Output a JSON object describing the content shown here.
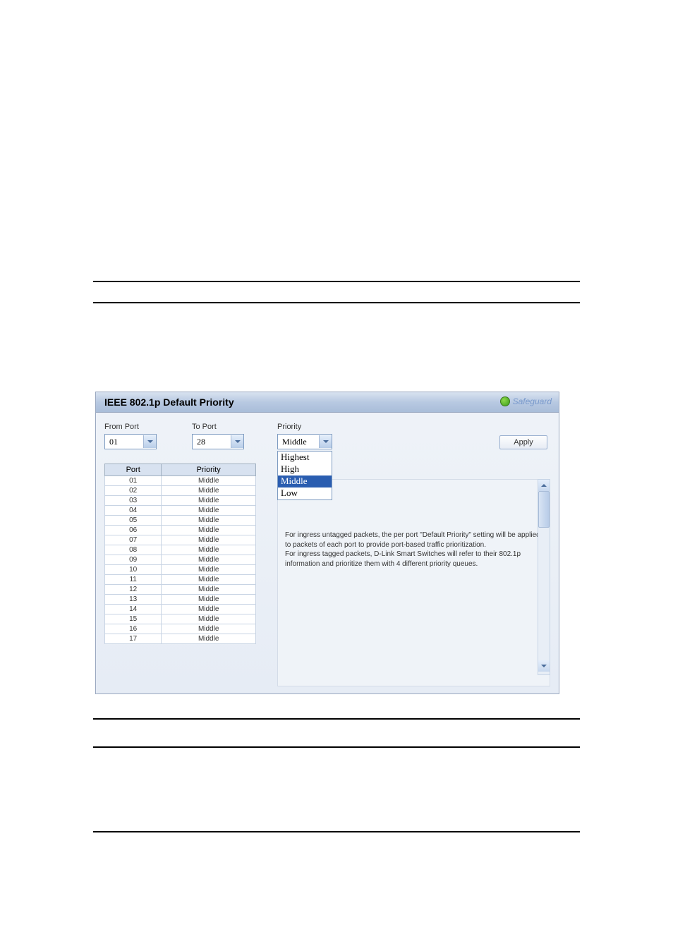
{
  "titlebar": {
    "title": "IEEE 802.1p Default Priority",
    "safeguard_text": "Safeguard"
  },
  "controls": {
    "from_port_label": "From Port",
    "from_port_value": "01",
    "to_port_label": "To Port",
    "to_port_value": "28",
    "priority_label": "Priority",
    "priority_value": "Middle",
    "apply_label": "Apply"
  },
  "dropdown_options": {
    "0": "Highest",
    "1": "High",
    "2": "Middle",
    "3": "Low"
  },
  "port_table": {
    "header_port": "Port",
    "header_priority": "Priority",
    "rows": [
      {
        "port": "01",
        "priority": "Middle"
      },
      {
        "port": "02",
        "priority": "Middle"
      },
      {
        "port": "03",
        "priority": "Middle"
      },
      {
        "port": "04",
        "priority": "Middle"
      },
      {
        "port": "05",
        "priority": "Middle"
      },
      {
        "port": "06",
        "priority": "Middle"
      },
      {
        "port": "07",
        "priority": "Middle"
      },
      {
        "port": "08",
        "priority": "Middle"
      },
      {
        "port": "09",
        "priority": "Middle"
      },
      {
        "port": "10",
        "priority": "Middle"
      },
      {
        "port": "11",
        "priority": "Middle"
      },
      {
        "port": "12",
        "priority": "Middle"
      },
      {
        "port": "13",
        "priority": "Middle"
      },
      {
        "port": "14",
        "priority": "Middle"
      },
      {
        "port": "15",
        "priority": "Middle"
      },
      {
        "port": "16",
        "priority": "Middle"
      },
      {
        "port": "17",
        "priority": "Middle"
      }
    ]
  },
  "help_text": {
    "line1": "For ingress untagged packets, the per port \"Default Priority\" setting will be applied to packets of each port to provide port-based traffic prioritization.",
    "line2": "For ingress tagged packets, D-Link Smart Switches will refer to their 802.1p information and prioritize them with 4 different priority queues."
  }
}
